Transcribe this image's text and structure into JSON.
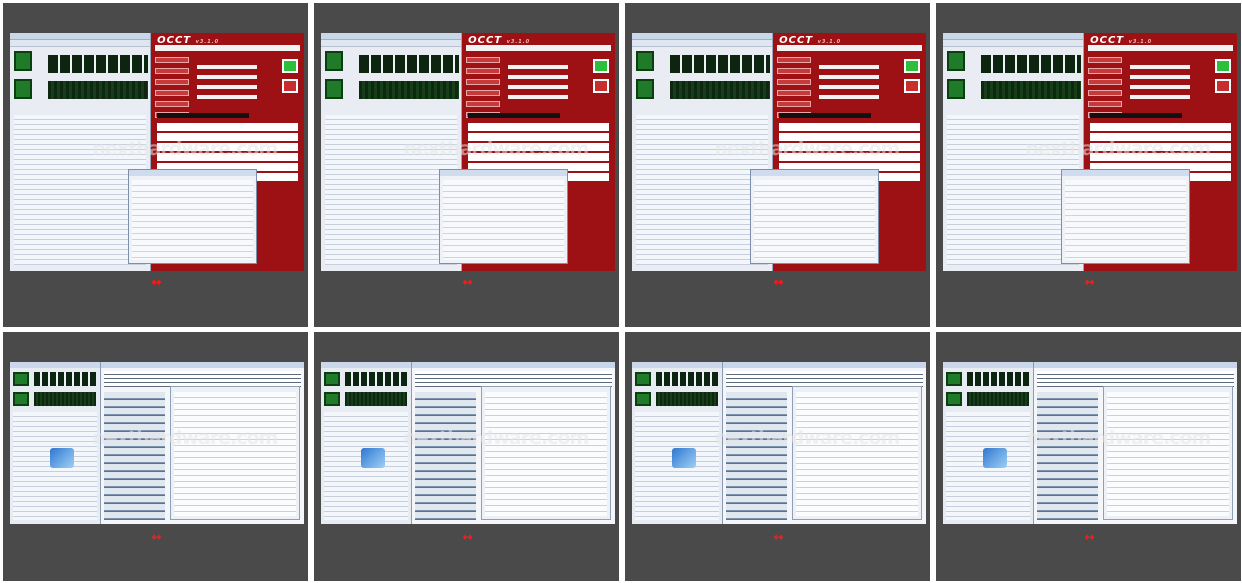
{
  "gallery": {
    "nav_label": "↔",
    "cells": [
      {
        "name": "thumb-occt-1",
        "type": "occt",
        "logo": "OCCT",
        "version": "v3.1.0",
        "watermark": "nexthardware.com"
      },
      {
        "name": "thumb-occt-2",
        "type": "occt",
        "logo": "OCCT",
        "version": "v3.1.0",
        "watermark": "nexthardware.com"
      },
      {
        "name": "thumb-occt-3",
        "type": "occt",
        "logo": "OCCT",
        "version": "v3.1.0",
        "watermark": "nexthardware.com"
      },
      {
        "name": "thumb-occt-4",
        "type": "occt",
        "logo": "OCCT",
        "version": "v3.1.0",
        "watermark": "nexthardware.com"
      },
      {
        "name": "thumb-prime-1",
        "type": "prime",
        "watermark": "nexthardware.com"
      },
      {
        "name": "thumb-prime-2",
        "type": "prime",
        "watermark": "nexthardware.com"
      },
      {
        "name": "thumb-prime-3",
        "type": "prime",
        "watermark": "nexthardware.com"
      },
      {
        "name": "thumb-prime-4",
        "type": "prime",
        "watermark": "nexthardware.com"
      }
    ]
  },
  "colors": {
    "cell_background": "#4a4a4a",
    "occt_red": "#9d1114",
    "nav_arrow": "#ff1a1a",
    "desktop_blue": "#3a6fc0"
  }
}
